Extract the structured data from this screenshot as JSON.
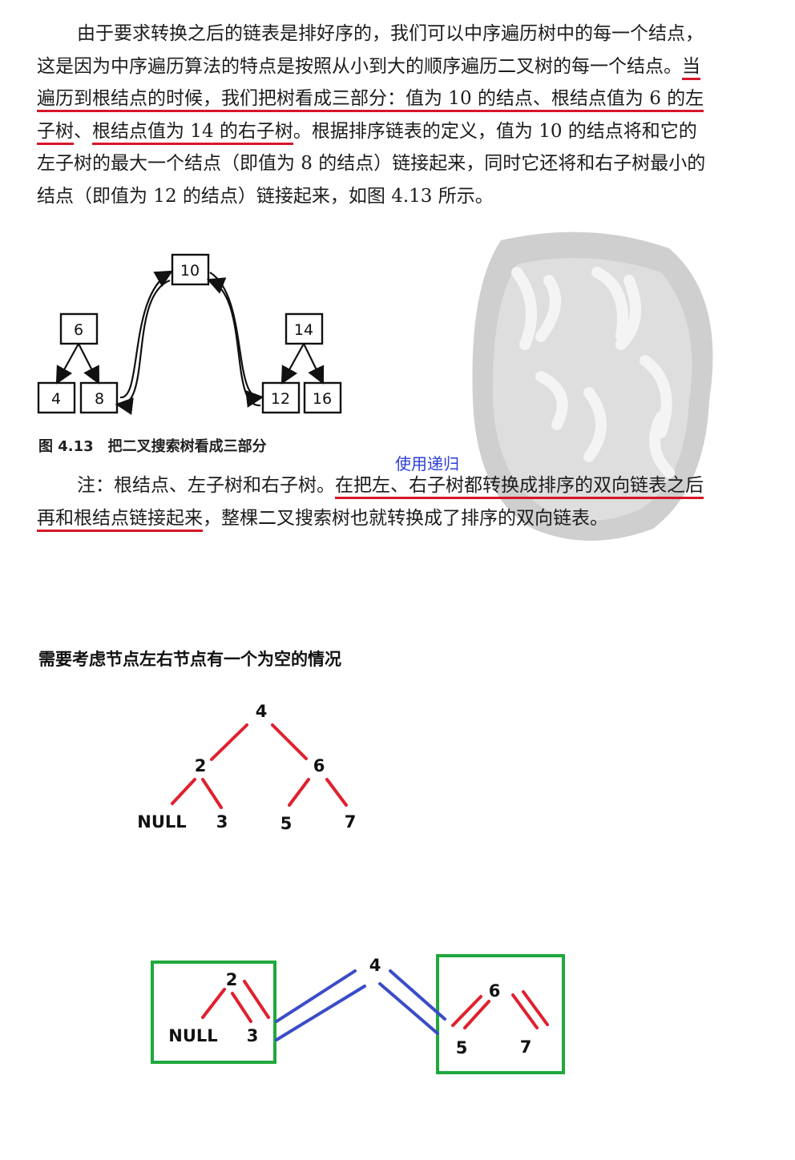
{
  "paragraph1": {
    "t1": "由于要求转换之后的链表是排好序的，我们可以中序遍历树中的每一个结点，这是因为中序遍历算法的特点是按照从小到大的顺序遍历二叉树的每一个结点。",
    "t2": "当遍历到根结点的时候，我们把树看成三部分：值为 10 的结点、根结点值为 6 的左子树",
    "t3": "、",
    "t4": "根结点值为 14 的右子树",
    "t5": "。根据排序链表的定义，值为 10 的结点将和它的左子树的最大一个结点（即值为 8 的结点）链接起来，同时它还将和右子树最小的结点（即值为 12 的结点）链接起来，如图 4.13 所示。"
  },
  "figure": {
    "nodes": {
      "root": "10",
      "left": "6",
      "left_l": "4",
      "left_r": "8",
      "right": "14",
      "right_l": "12",
      "right_r": "16"
    },
    "caption": "图 4.13　把二叉搜索树看成三部分"
  },
  "handwritten_note": "使用递归",
  "paragraph2": {
    "t1": "注：根结点、左子树和右子树。",
    "t2": "在把左、右子树都转换成排序的双向链表之后再和根结点链接起来",
    "t3": "，整棵二叉搜索树也就转换成了排序的双向链表。"
  },
  "heading": "需要考虑节点左右节点有一个为空的情况",
  "tree1": {
    "root": "4",
    "l": "2",
    "r": "6",
    "ll": "NULL",
    "lr": "3",
    "rl": "5",
    "rr": "7"
  },
  "tree2": {
    "root": "4",
    "l": "2",
    "r": "6",
    "ll": "NULL",
    "lr": "3",
    "rl": "5",
    "rr": "7"
  },
  "colors": {
    "red": "#e0202e",
    "blue": "#3a4cc7",
    "green": "#1fa83c",
    "note_blue": "#2b3fd6"
  }
}
